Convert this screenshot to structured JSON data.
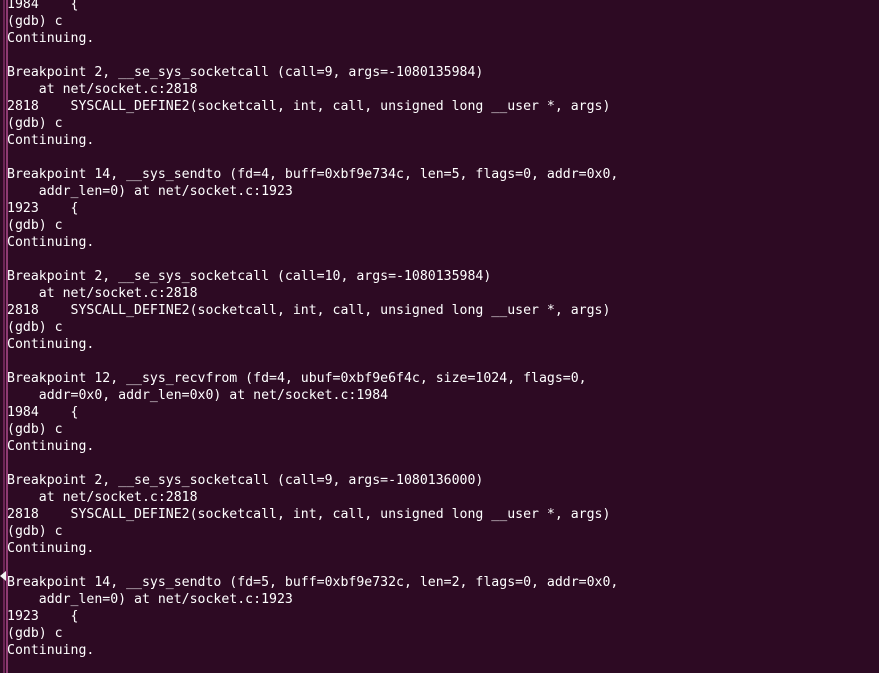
{
  "terminal": {
    "app": "gdb-console",
    "background_color": "#2d0a23",
    "foreground_color": "#ffffff",
    "scrollbar_track_color": "#6d2556",
    "scrollbar_thumb_color": "#8d3a71",
    "scroll_marker_icon": "left-triangle-marker",
    "prompt": "(gdb)",
    "lines": [
      "1984\t{",
      "(gdb) c",
      "Continuing.",
      "",
      "Breakpoint 2, __se_sys_socketcall (call=9, args=-1080135984)",
      "    at net/socket.c:2818",
      "2818\tSYSCALL_DEFINE2(socketcall, int, call, unsigned long __user *, args)",
      "(gdb) c",
      "Continuing.",
      "",
      "Breakpoint 14, __sys_sendto (fd=4, buff=0xbf9e734c, len=5, flags=0, addr=0x0,",
      "    addr_len=0) at net/socket.c:1923",
      "1923\t{",
      "(gdb) c",
      "Continuing.",
      "",
      "Breakpoint 2, __se_sys_socketcall (call=10, args=-1080135984)",
      "    at net/socket.c:2818",
      "2818\tSYSCALL_DEFINE2(socketcall, int, call, unsigned long __user *, args)",
      "(gdb) c",
      "Continuing.",
      "",
      "Breakpoint 12, __sys_recvfrom (fd=4, ubuf=0xbf9e6f4c, size=1024, flags=0,",
      "    addr=0x0, addr_len=0x0) at net/socket.c:1984",
      "1984\t{",
      "(gdb) c",
      "Continuing.",
      "",
      "Breakpoint 2, __se_sys_socketcall (call=9, args=-1080136000)",
      "    at net/socket.c:2818",
      "2818\tSYSCALL_DEFINE2(socketcall, int, call, unsigned long __user *, args)",
      "(gdb) c",
      "Continuing.",
      "",
      "Breakpoint 14, __sys_sendto (fd=5, buff=0xbf9e732c, len=2, flags=0, addr=0x0,",
      "    addr_len=0) at net/socket.c:1923",
      "1923\t{",
      "(gdb) c",
      "Continuing."
    ]
  }
}
